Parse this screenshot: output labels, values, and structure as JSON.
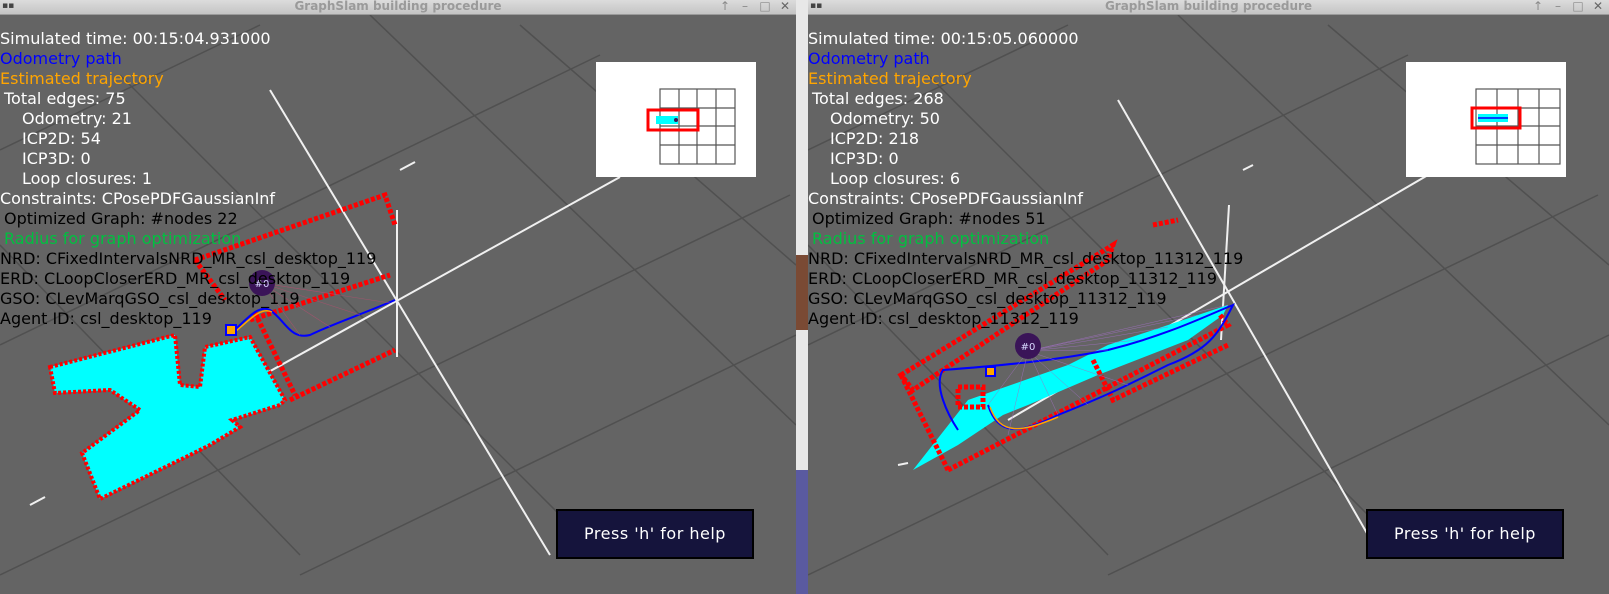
{
  "windows": [
    {
      "title": "GraphSlam building procedure",
      "sim_time": "Simulated time: 00:15:04.931000",
      "legend_odometry": "Odometry path",
      "legend_estimated": "Estimated trajectory",
      "total_edges": "Total edges: 75",
      "odometry": "Odometry: 21",
      "icp2d": "ICP2D: 54",
      "icp3d": "ICP3D: 0",
      "loop_closures": "Loop closures: 1",
      "constraints": "Constraints: CPosePDFGaussianInf",
      "optimized_graph": "Optimized Graph: #nodes 22",
      "radius": "Radius for graph optimization",
      "nrd": "NRD: CFixedIntervalsNRD_MR_csl_desktop_119",
      "erd": "ERD: CLoopCloserERD_MR_csl_desktop_119",
      "gso": "GSO: CLevMarqGSO_csl_desktop_119",
      "agent_id": "Agent ID: csl_desktop_119",
      "node_label": "#0",
      "help": "Press 'h' for help"
    },
    {
      "title": "GraphSlam building procedure",
      "sim_time": "Simulated time: 00:15:05.060000",
      "legend_odometry": "Odometry path",
      "legend_estimated": "Estimated trajectory",
      "total_edges": "Total edges: 268",
      "odometry": "Odometry: 50",
      "icp2d": "ICP2D: 218",
      "icp3d": "ICP3D: 0",
      "loop_closures": "Loop closures: 6",
      "constraints": "Constraints: CPosePDFGaussianInf",
      "optimized_graph": "Optimized Graph: #nodes 51",
      "radius": "Radius for graph optimization",
      "nrd": "NRD: CFixedIntervalsNRD_MR_csl_desktop_11312_119",
      "erd": "ERD: CLoopCloserERD_MR_csl_desktop_11312_119",
      "gso": "GSO: CLevMarqGSO_csl_desktop_11312_119",
      "agent_id": "Agent ID: csl_desktop_11312_119",
      "node_label": "#0",
      "help": "Press 'h' for help"
    }
  ],
  "colors": {
    "viewport_bg": "#646464",
    "grid": "#505050",
    "laser_map": "#ff0000",
    "free_space": "#00ffff",
    "odometry_path": "#0000ff",
    "estimated_trajectory": "#ffa500",
    "radius_text": "#00c040",
    "node": "#3a1458",
    "help_bg": "#15143c"
  },
  "icons": {
    "app": "mrpt-app-icon",
    "minimize": "minimize-icon",
    "maximize": "maximize-icon",
    "close": "close-icon"
  }
}
